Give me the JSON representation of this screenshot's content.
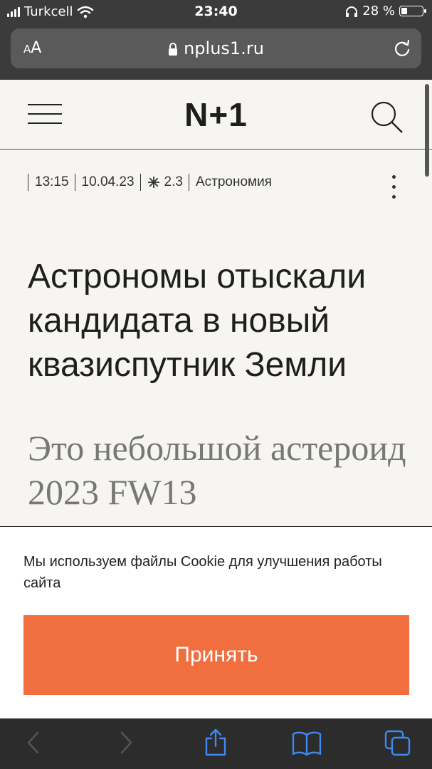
{
  "status_bar": {
    "carrier": "Turkcell",
    "time": "23:40",
    "battery_text": "28 %",
    "battery_level": 0.28
  },
  "browser": {
    "text_size_button": "AA",
    "url": "nplus1.ru"
  },
  "site_header": {
    "logo": "N+1"
  },
  "article": {
    "time": "13:15",
    "date": "10.04.23",
    "difficulty": "2.3",
    "category": "Астрономия",
    "title": "Астрономы отыскали кандидата в новый квазиспутник Земли",
    "subtitle": "Это небольшой астероид 2023 FW13"
  },
  "cookie_banner": {
    "text": "Мы используем файлы Cookie для улучшения работы сайта",
    "accept_label": "Принять"
  },
  "toolbar": {
    "icons": [
      "back-icon",
      "forward-icon",
      "share-icon",
      "bookmarks-icon",
      "tabs-icon"
    ],
    "accent_color": "#3d8bf2"
  },
  "colors": {
    "accept_button": "#f16e3f",
    "browser_chrome": "#3b3b3b",
    "page_background": "#f6f5f2"
  }
}
